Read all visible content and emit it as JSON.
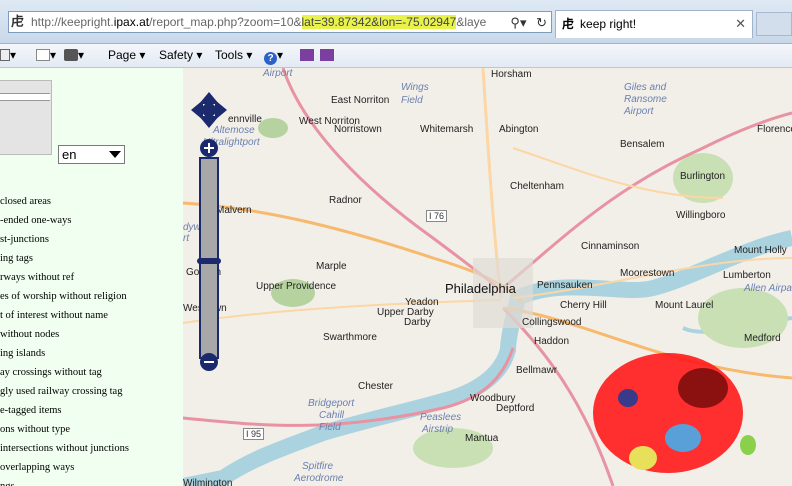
{
  "address_bar": {
    "url_prefix": "http://keepright.",
    "url_domain": "ipax.at",
    "url_path": "/report_map.php?zoom=10&",
    "url_highlight": "lat=39.87342&lon=-75.02947",
    "url_suffix": "&laye"
  },
  "tab": {
    "title": "keep right!"
  },
  "command_bar": {
    "page_label": "Page ▾",
    "safety_label": "Safety ▾",
    "tools_label": "Tools ▾"
  },
  "sidebar": {
    "language": "en",
    "items": [
      "closed areas",
      "-ended one-ways",
      "st-junctions",
      "ing tags",
      "rways without ref",
      "es of worship without religion",
      "t of interest without name",
      " without nodes",
      "ing islands",
      "ay crossings without tag",
      "gly used railway crossing tag",
      "e-tagged items",
      "ons without type",
      "intersections without junctions",
      "overlapping ways",
      "ngs"
    ]
  },
  "map": {
    "places": {
      "horsham": "Horsham",
      "airport": "Airport",
      "east_norriton": "East Norriton",
      "wings_field": "Wings",
      "wings_field2": "Field",
      "giles": "Giles and",
      "giles2": "Ransome",
      "giles3": "Airport",
      "pennville": "ennville",
      "altemose": "Altemose",
      "altemose2": "Ultralightport",
      "west_norriton": "West Norriton",
      "norristown": "Norristown",
      "whitemarsh": "Whitemarsh",
      "abington": "Abington",
      "florence": "Florence",
      "bensalem": "Bensalem",
      "cheltenham": "Cheltenham",
      "burlington": "Burlington",
      "malvern": "Malvern",
      "radnor": "Radnor",
      "willingboro": "Willingboro",
      "brandywine": "dywine",
      "brandywine2": "rt",
      "cinnaminson": "Cinnaminson",
      "mount_holly": "Mount Holly",
      "marple": "Marple",
      "goshen": "Goshen",
      "upper_providence": "Upper Providence",
      "philadelphia": "Philadelphia",
      "pennsauken": "Pennsauken",
      "moorestown": "Moorestown",
      "lumberton": "Lumberton",
      "allen_airpark": "Allen Airpark",
      "westtown": "Westtown",
      "yeadon": "Yeadon",
      "upper_darby": "Upper Darby",
      "darby": "Darby",
      "cherry_hill": "Cherry Hill",
      "mount_laurel": "Mount Laurel",
      "swarthmore": "Swarthmore",
      "collingswood": "Collingswood",
      "haddon": "Haddon",
      "medford": "Medford",
      "bellmawr": "Bellmawr",
      "chester": "Chester",
      "bridgeport": "Bridgeport",
      "bridgeport2": "Cahill",
      "bridgeport3": "Field",
      "woodbury": "Woodbury",
      "deptford": "Deptford",
      "peaslees": "Peaslees",
      "peaslees2": "Airstrip",
      "mantua": "Mantua",
      "spitfire": "Spitfire",
      "spitfire2": "Aerodrome",
      "wilmington": "Wilmington"
    },
    "shields": {
      "i76": "I 76",
      "i95": "I 95"
    }
  },
  "colors": {
    "sidebar_bg": "#f0fff0",
    "url_highlight": "#e8f24a",
    "error_marker": "#ff0000",
    "zoom_bar": "#1a2a6c"
  },
  "icons": [
    "search-icon",
    "refresh-icon",
    "close-icon",
    "print-icon",
    "mail-icon",
    "help-icon",
    "airport-icon"
  ]
}
